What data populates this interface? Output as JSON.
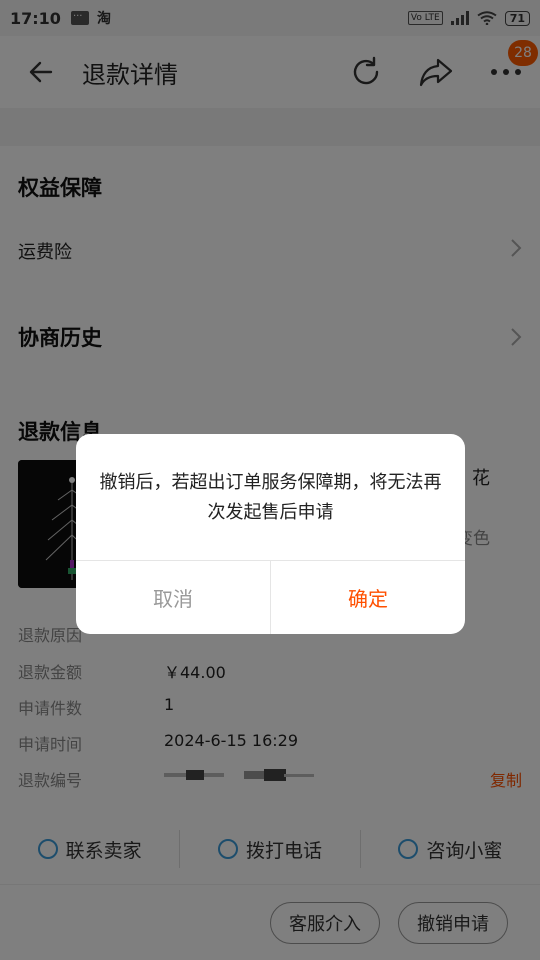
{
  "status_bar": {
    "time": "17:10",
    "app_indicator": "淘",
    "volte": "Vo LTE",
    "battery": "71"
  },
  "header": {
    "title": "退款详情",
    "badge": "28"
  },
  "rights": {
    "title": "权益保障",
    "item": "运费险"
  },
  "history": {
    "title": "协商历史"
  },
  "refund": {
    "title": "退款信息",
    "product_name": "花",
    "product_spec": "变色",
    "fields": [
      {
        "label": "退款原因",
        "value": ""
      },
      {
        "label": "退款金额",
        "value": "￥44.00"
      },
      {
        "label": "申请件数",
        "value": "1"
      },
      {
        "label": "申请时间",
        "value": "2024-6-15 16:29"
      },
      {
        "label": "退款编号",
        "value": "",
        "action": "复制"
      }
    ]
  },
  "contact": [
    {
      "label": "联系卖家",
      "icon": "smile-icon"
    },
    {
      "label": "拨打电话",
      "icon": "phone-icon"
    },
    {
      "label": "咨询小蜜",
      "icon": "assistant-icon"
    }
  ],
  "bottom_buttons": {
    "service": "客服介入",
    "cancel_request": "撤销申请"
  },
  "dialog": {
    "message": "撤销后，若超出订单服务保障期，将无法再次发起售后申请",
    "cancel": "取消",
    "confirm": "确定"
  },
  "colors": {
    "accent": "#ff5000",
    "badge": "#ff5a00"
  }
}
